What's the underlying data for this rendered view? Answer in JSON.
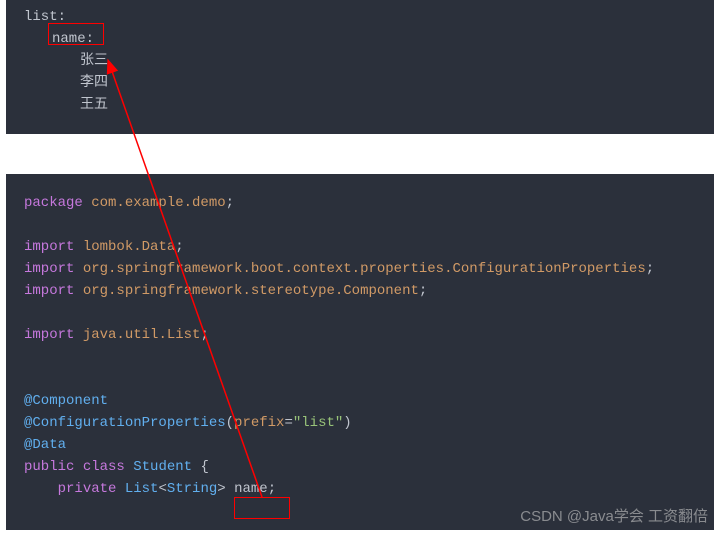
{
  "top": {
    "listLabel": "list:",
    "nameLabel": "name:",
    "items": [
      "张三",
      "李四",
      "王五"
    ]
  },
  "code": {
    "packageKw": "package",
    "packageName": "com.example.demo",
    "semi": ";",
    "importKw": "import",
    "imports": [
      "lombok.Data",
      "org.springframework.boot.context.properties.ConfigurationProperties",
      "org.springframework.stereotype.Component",
      "java.util.List"
    ],
    "ann1": "@Component",
    "ann2a": "@ConfigurationProperties",
    "ann2paren_open": "(",
    "ann2prefix": "prefix",
    "ann2eq": "=",
    "ann2val": "\"list\"",
    "ann2paren_close": ")",
    "ann3": "@Data",
    "publicKw": "public",
    "classKw": "class",
    "className": "Student",
    "braceOpen": " {",
    "privateKw": "private",
    "listType": "List",
    "lt": "<",
    "stringType": "String",
    "gt": ">",
    "fieldName": " name",
    "fieldSemi": ";"
  },
  "watermark": "CSDN @Java学会 工资翻倍"
}
